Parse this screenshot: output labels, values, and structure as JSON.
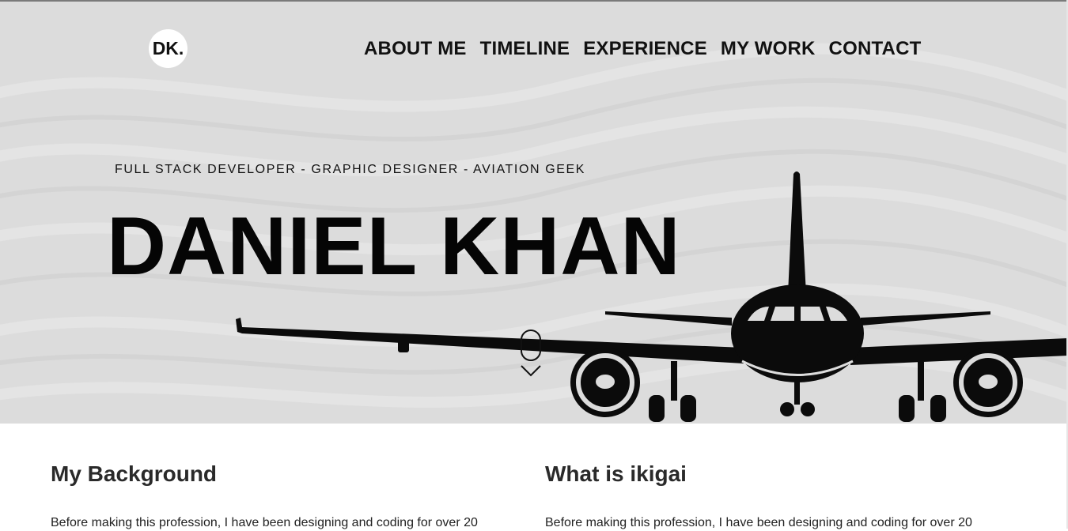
{
  "header": {
    "logo_text": "DK.",
    "nav": [
      {
        "label": "ABOUT ME"
      },
      {
        "label": "TIMELINE"
      },
      {
        "label": "EXPERIENCE"
      },
      {
        "label": "MY WORK"
      },
      {
        "label": "CONTACT"
      }
    ]
  },
  "hero": {
    "tagline": "FULL STACK DEVELOPER - GRAPHIC DESIGNER - AVIATION GEEK",
    "name": "DANIEL KHAN",
    "background_color": "#dcdcdc",
    "illustration_icon": "airplane-icon",
    "scroll_icon": "mouse-scroll-icon"
  },
  "sections": [
    {
      "title": "My Background",
      "body": "Before making this profession, I have been designing and coding for over 20"
    },
    {
      "title": "What is ikigai",
      "body": "Before making this profession, I have been designing and coding for over 20"
    }
  ]
}
